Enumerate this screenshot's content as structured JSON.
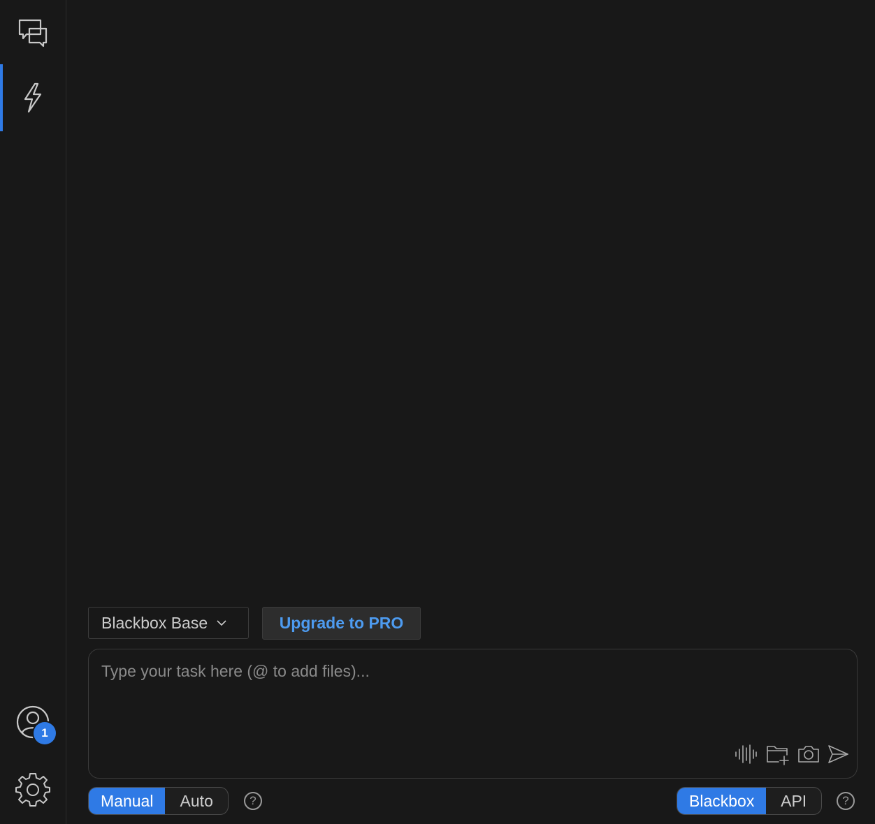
{
  "sidebar": {
    "items": [
      {
        "name": "chat",
        "icon": "chat-bubbles-icon",
        "active": false
      },
      {
        "name": "agent",
        "icon": "lightning-icon",
        "active": true
      }
    ],
    "account": {
      "icon": "user-circle-icon",
      "badge": "1"
    },
    "settings": {
      "icon": "gear-icon"
    }
  },
  "toolbar": {
    "model_label": "Blackbox Base",
    "upgrade_label": "Upgrade to PRO"
  },
  "task": {
    "placeholder": "Type your task here (@ to add files)...",
    "value": "",
    "tools": [
      "waveform-icon",
      "folder-plus-icon",
      "camera-icon",
      "send-icon"
    ]
  },
  "mode": {
    "options": [
      "Manual",
      "Auto"
    ],
    "selected": "Manual",
    "help": "?"
  },
  "provider": {
    "options": [
      "Blackbox",
      "API"
    ],
    "selected": "Blackbox",
    "help": "?"
  },
  "colors": {
    "accent": "#2f7ae5",
    "background": "#181818",
    "upgrade_text": "#4d9bf0"
  }
}
